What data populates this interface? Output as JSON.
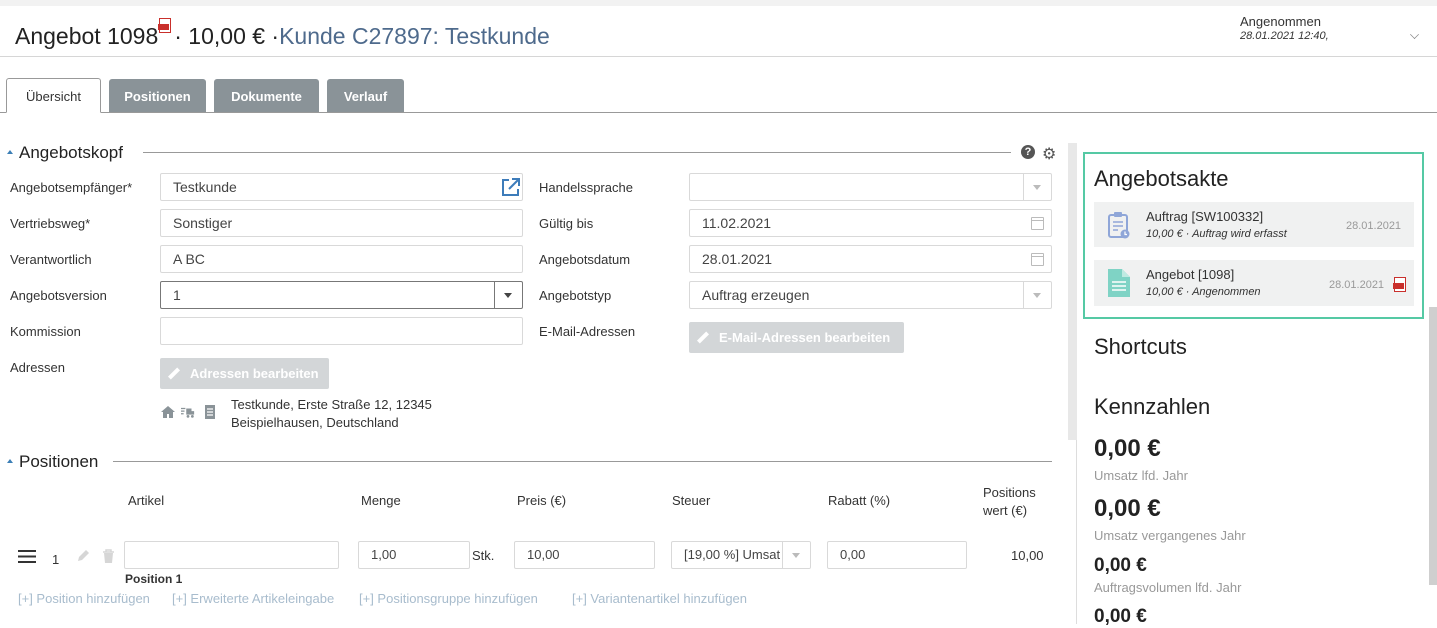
{
  "header": {
    "title_prefix": "Angebot 1098",
    "title_amount": "· 10,00 € ·",
    "customer_link": "Kunde C27897: Testkunde",
    "status": "Angenommen",
    "status_date": "28.01.2021 12:40,",
    "pdf_icon": "pdf-icon",
    "expand_icon": "chevron-down-icon"
  },
  "tabs": [
    {
      "label": "Übersicht",
      "active": true
    },
    {
      "label": "Positionen",
      "active": false
    },
    {
      "label": "Dokumente",
      "active": false
    },
    {
      "label": "Verlauf",
      "active": false
    }
  ],
  "angebotskopf": {
    "heading": "Angebotskopf",
    "help_icon": "?",
    "gear_icon": "⚙",
    "left_fields": [
      {
        "label": "Angebotsempfänger*",
        "value": "Testkunde"
      },
      {
        "label": "Vertriebsweg*",
        "value": "Sonstiger"
      },
      {
        "label": "Verantwortlich",
        "value": "A BC"
      },
      {
        "label": "Angebotsversion",
        "value": "1"
      },
      {
        "label": "Kommission",
        "value": ""
      },
      {
        "label": "Adressen",
        "button": "Adressen bearbeiten"
      }
    ],
    "right_fields": [
      {
        "label": "Handelssprache",
        "value": ""
      },
      {
        "label": "Gültig bis",
        "value": "11.02.2021"
      },
      {
        "label": "Angebotsdatum",
        "value": "28.01.2021"
      },
      {
        "label": "Angebotstyp",
        "value": "Auftrag erzeugen"
      },
      {
        "label": "E-Mail-Adressen",
        "button": "E-Mail-Adressen bearbeiten"
      }
    ],
    "address_line1": "Testkunde, Erste Straße 12, 12345",
    "address_line2": "Beispielhausen, Deutschland"
  },
  "positionen": {
    "heading": "Positionen",
    "columns": {
      "artikel": "Artikel",
      "menge": "Menge",
      "preis": "Preis (€)",
      "steuer": "Steuer",
      "rabatt": "Rabatt (%)",
      "wert_line1": "Positions",
      "wert_line2": "wert (€)"
    },
    "row": {
      "number": "1",
      "artikel": "",
      "menge": "1,00",
      "unit": "Stk.",
      "preis": "10,00",
      "steuer": "[19,00 %] Umsat",
      "rabatt": "0,00",
      "wert": "10,00",
      "name": "Position 1"
    },
    "add_links": [
      "[+] Position hinzufügen",
      "[+] Erweiterte Artikeleingabe",
      "[+] Positionsgruppe hinzufügen",
      "[+] Variantenartikel hinzufügen"
    ]
  },
  "sidebar": {
    "akte_heading": "Angebotsakte",
    "documents": [
      {
        "title": "Auftrag [SW100332]",
        "subtitle": "10,00 € · Auftrag wird erfasst",
        "date": "28.01.2021",
        "icon": "clipboard-icon"
      },
      {
        "title": "Angebot [1098]",
        "subtitle": "10,00 € · Angenommen",
        "date": "28.01.2021",
        "icon": "document-icon"
      }
    ],
    "shortcuts_heading": "Shortcuts",
    "kennzahlen_heading": "Kennzahlen",
    "kpis": [
      {
        "value": "0,00 €",
        "label": "Umsatz lfd. Jahr"
      },
      {
        "value": "0,00 €",
        "label": "Umsatz vergangenes Jahr"
      },
      {
        "value": "0,00 €",
        "label": "Auftragsvolumen lfd. Jahr"
      },
      {
        "value": "0,00 €",
        "label": ""
      }
    ]
  },
  "colors": {
    "accent_link": "#4e6a8c",
    "tab_inactive": "#8a9398",
    "akte_border": "#55c9a4",
    "doc_icon": "#8fa6d8",
    "doc_icon_teal": "#7fd3c5",
    "pdf_red": "#c9302c"
  }
}
